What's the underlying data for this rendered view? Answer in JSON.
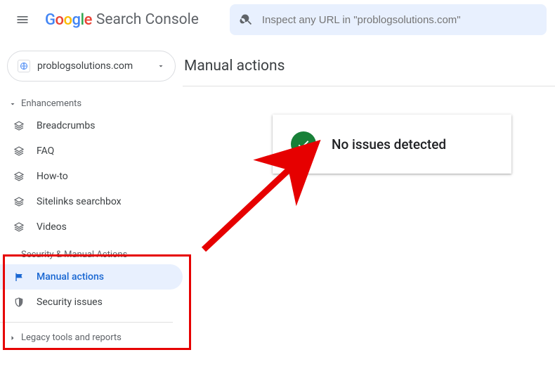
{
  "header": {
    "product_name": "Search Console",
    "search_placeholder": "Inspect any URL in \"problogsolutions.com\""
  },
  "property_selector": {
    "name": "problogsolutions.com"
  },
  "sidebar": {
    "section_enhancements": "Enhancements",
    "items_enh": [
      "Breadcrumbs",
      "FAQ",
      "How-to",
      "Sitelinks searchbox",
      "Videos"
    ],
    "section_security": "Security & Manual Actions",
    "item_manual_actions": "Manual actions",
    "item_security_issues": "Security issues",
    "section_legacy": "Legacy tools and reports"
  },
  "page": {
    "title": "Manual actions",
    "status_message": "No issues detected"
  }
}
